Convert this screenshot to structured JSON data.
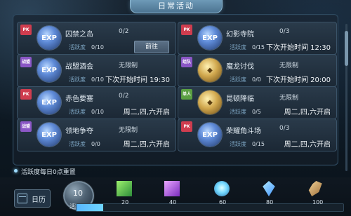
{
  "header": {
    "title": "日常活动"
  },
  "activities": [
    {
      "badge": "PK",
      "icon": "exp",
      "name": "囚禁之岛",
      "count": "0/2",
      "activity_label": "活跃度",
      "activity_value": "0/10",
      "right_text": "前往",
      "right_type": "button"
    },
    {
      "badge": "PK",
      "icon": "exp",
      "name": "幻影寺院",
      "count": "0/3",
      "activity_label": "活跃度",
      "activity_value": "0/15",
      "right_text": "下次开始时间  12:30",
      "right_type": "text"
    },
    {
      "badge": "战盟",
      "icon": "exp",
      "name": "战盟酒会",
      "count": "无限制",
      "activity_label": "活跃度",
      "activity_value": "0/10",
      "right_text": "下次开始时间  19:30",
      "right_type": "text"
    },
    {
      "badge": "组队",
      "icon": "gold",
      "name": "魔龙讨伐",
      "count": "无限制",
      "activity_label": "活跃度",
      "activity_value": "0/0",
      "right_text": "下次开始时间  20:00",
      "right_type": "text"
    },
    {
      "badge": "PK",
      "icon": "exp",
      "name": "赤色要塞",
      "count": "0/2",
      "activity_label": "活跃度",
      "activity_value": "0/10",
      "right_text": "周二,四,六开启",
      "right_type": "text"
    },
    {
      "badge": "单人",
      "icon": "gold",
      "name": "昆顿降临",
      "count": "无限制",
      "activity_label": "活跃度",
      "activity_value": "0/5",
      "right_text": "周二,四,六开启",
      "right_type": "text"
    },
    {
      "badge": "战盟",
      "icon": "exp",
      "name": "领地争夺",
      "count": "无限制",
      "activity_label": "活跃度",
      "activity_value": "0/0",
      "right_text": "周二,四,六开启",
      "right_type": "text"
    },
    {
      "badge": "PK",
      "icon": "exp",
      "name": "荣耀角斗场",
      "count": "0/3",
      "activity_label": "活跃度",
      "activity_value": "0/15",
      "right_text": "周二,四,六开启",
      "right_type": "text"
    }
  ],
  "footer": {
    "reset_text": "活跃度每日0点重置",
    "calendar_label": "日历",
    "score_value": "10",
    "score_label": "活跃度",
    "progress_fraction": 0.1,
    "rewards": [
      {
        "value": "20",
        "icon": "green-relic-icon"
      },
      {
        "value": "40",
        "icon": "purple-relic-icon"
      },
      {
        "value": "60",
        "icon": "orb-icon"
      },
      {
        "value": "80",
        "icon": "diamond-icon"
      },
      {
        "value": "100",
        "icon": "scroll-icon"
      }
    ]
  }
}
